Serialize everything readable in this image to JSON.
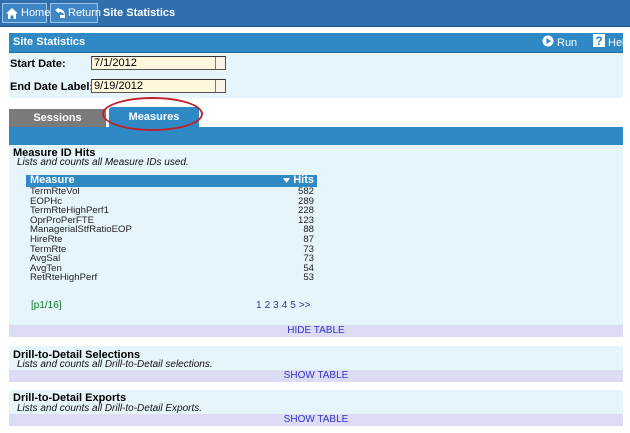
{
  "nav": {
    "home_label": "Home",
    "return_label": "Return",
    "page_title": "Site Statistics"
  },
  "panel": {
    "title": "Site Statistics",
    "run_label": "Run",
    "help_label": "Help"
  },
  "form": {
    "start_label": "Start Date:",
    "start_value": "7/1/2012",
    "end_label": "End Date Label:",
    "end_value": "9/19/2012"
  },
  "tabs": [
    {
      "label": "Sessions",
      "active": false
    },
    {
      "label": "Measures",
      "active": true
    }
  ],
  "measure_section": {
    "title": "Measure ID Hits",
    "description": "Lists and counts all Measure IDs used.",
    "columns": [
      "Measure",
      "Hits"
    ],
    "rows": [
      {
        "measure": "TermRteVol",
        "hits": "582"
      },
      {
        "measure": "EOPHc",
        "hits": "289"
      },
      {
        "measure": "TermRteHighPerf1",
        "hits": "228"
      },
      {
        "measure": "OprProPerFTE",
        "hits": "123"
      },
      {
        "measure": "ManagerialStfRatioEOP",
        "hits": "88"
      },
      {
        "measure": "HireRte",
        "hits": "87"
      },
      {
        "measure": "TermRte",
        "hits": "73"
      },
      {
        "measure": "AvgSal",
        "hits": "73"
      },
      {
        "measure": "AvgTen",
        "hits": "54"
      },
      {
        "measure": "RetRteHighPerf",
        "hits": "53"
      }
    ],
    "page_indicator": "[p1/16]",
    "pages": [
      "1",
      "2",
      "3",
      "4",
      "5",
      ">>"
    ],
    "toggle_label": "HIDE TABLE"
  },
  "drill_selections": {
    "title": "Drill-to-Detail Selections",
    "description": "Lists and counts all Drill-to-Detail selections.",
    "toggle_label": "SHOW TABLE"
  },
  "drill_exports": {
    "title": "Drill-to-Detail Exports",
    "description": "Lists and counts all Drill-to-Detail Exports.",
    "toggle_label": "SHOW TABLE"
  },
  "colors": {
    "nav_bg": "#2f6fad",
    "panel_blue": "#2e89c5",
    "content_bg": "#e6f5fa",
    "highlight_ellipse": "#c0202a",
    "link_color": "#3333cc"
  }
}
